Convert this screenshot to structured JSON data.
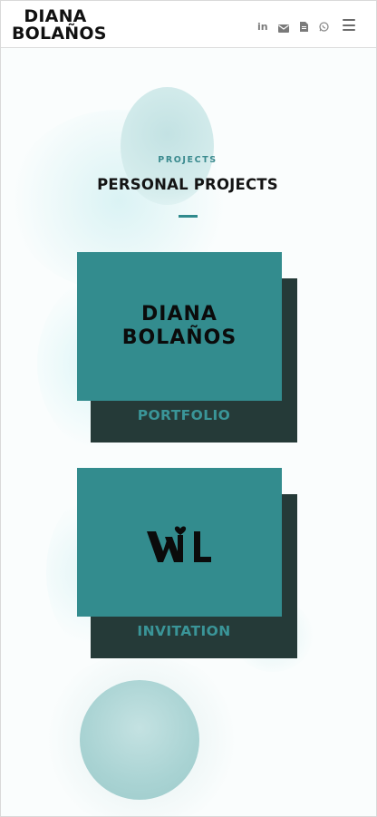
{
  "header": {
    "logo_line1": "DIANA",
    "logo_line2": "BOLAÑOS",
    "social_icons": [
      "linkedin-icon",
      "mail-icon",
      "document-icon",
      "whatsapp-icon"
    ],
    "menu_icon": "hamburger-menu-icon",
    "social_linkedin_text": "in"
  },
  "section": {
    "eyebrow": "PROJECTS",
    "title": "PERSONAL PROJECTS"
  },
  "projects": [
    {
      "label": "PORTFOLIO",
      "logo_line1": "DIANA",
      "logo_line2": "BOLAÑOS",
      "logo_icon": "diana-bolanos-logo"
    },
    {
      "label": "INVITATION",
      "logo_icon": "wl-monogram-heart-logo"
    }
  ],
  "colors": {
    "accent": "#338c8e",
    "card_shadow": "#253a38",
    "label": "#3a9598",
    "eyebrow": "#3a8a8e",
    "text_dark": "#141414"
  }
}
